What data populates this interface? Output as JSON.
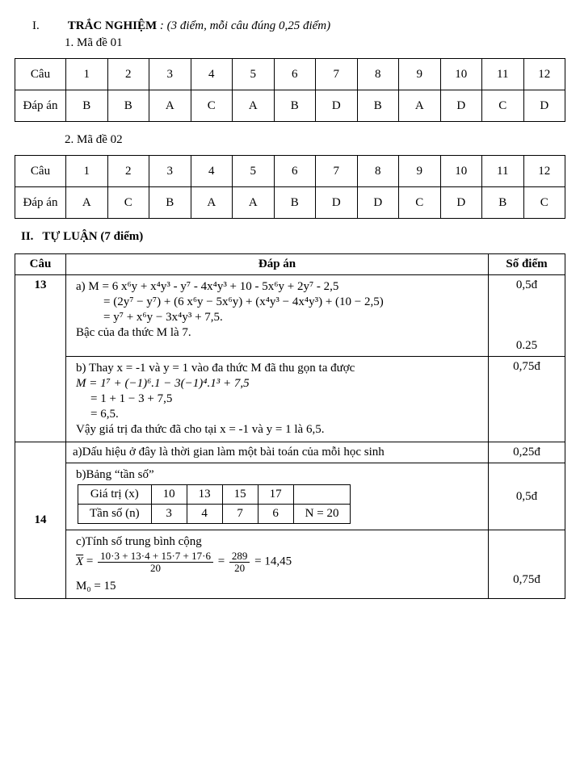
{
  "section1": {
    "roman": "I.",
    "title": "TRẮC NGHIỆM",
    "note": ": (3 điểm,  mỗi câu đúng 0,25 điểm)",
    "m1": "1. Mã đề 01",
    "m2": "2. Mã đề 02"
  },
  "cols": {
    "h": "Câu",
    "a": "Đáp án",
    "n": [
      "1",
      "2",
      "3",
      "4",
      "5",
      "6",
      "7",
      "8",
      "9",
      "10",
      "11",
      "12"
    ]
  },
  "t1": [
    "B",
    "B",
    "A",
    "C",
    "A",
    "B",
    "D",
    "B",
    "A",
    "D",
    "C",
    "D"
  ],
  "t2": [
    "A",
    "C",
    "B",
    "A",
    "A",
    "B",
    "D",
    "D",
    "C",
    "D",
    "B",
    "C"
  ],
  "section2": {
    "roman": "II.",
    "title": "TỰ LUẬN (7 điểm)"
  },
  "solhead": {
    "c1": "Câu",
    "c2": "Đáp án",
    "c3": "Số điểm"
  },
  "q13": {
    "num": "13",
    "a_l1": "a)  M  =  6 x⁶y  + x⁴y³ -  y⁷ -  4x⁴y³ + 10  -  5x⁶y  +  2y⁷ -  2,5",
    "a_l2": "= (2y⁷ − y⁷) + (6 x⁶y − 5x⁶y) + (x⁴y³ −  4x⁴y³) + (10 − 2,5)",
    "a_l3": "=  y⁷ + x⁶y − 3x⁴y³ + 7,5.",
    "a_l4": "Bậc của  đa thức M là 7.",
    "a_pt": "0,5đ",
    "a_pt2": "0.25",
    "b_l1": "b)  Thay x = -1 và y = 1 vào đa thức M đã thu gọn ta được",
    "b_l2": "M = 1⁷ + (−1)⁶.1 − 3(−1)⁴.1³ + 7,5",
    "b_l3": "= 1 + 1 − 3 + 7,5",
    "b_l4": "= 6,5.",
    "b_l5": "Vậy giá trị đa thức đã cho tại x = -1 và y = 1 là 6,5.",
    "b_pt": "0,75đ"
  },
  "q14": {
    "num": "14",
    "a_l1": "a)Dấu hiệu ở đây là thời gian làm một bài toán của mỗi học sinh",
    "a_pt": "0,25đ",
    "b_l1": "b)Bảng “tần số”",
    "freq": {
      "r1h": "Giá trị (x)",
      "r1": [
        "10",
        "13",
        "15",
        "17",
        ""
      ],
      "r2h": "Tần số (n)",
      "r2": [
        "3",
        "4",
        "7",
        "6",
        "N = 20"
      ]
    },
    "b_pt": "0,5đ",
    "c_l1": "c)Tính số trung bình cộng",
    "c_num": "10·3 + 13·4 + 15·7 + 17·6",
    "c_den": "20",
    "c_num2": "289",
    "c_res": "= 14,45",
    "c_l3": "M₀ = 15",
    "c_pt": "0,75đ"
  }
}
